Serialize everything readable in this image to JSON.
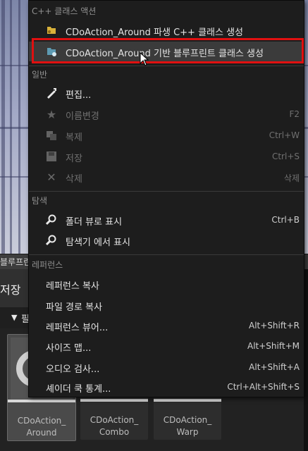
{
  "background": {
    "blueprint_tab": "블루프린",
    "save_label": "저장",
    "filter_label": "필"
  },
  "assets": [
    {
      "line1": "",
      "line2": "",
      "name_line1": "CDoAction_",
      "name_line2": "Around"
    },
    {
      "name_line1": "CDoAction_",
      "name_line2": "Combo"
    },
    {
      "name_line1": "CDoAction_",
      "name_line2": "Warp"
    }
  ],
  "menu": {
    "sections": {
      "cpp_actions": "C++ 클래스 액션",
      "general": "일반",
      "explore": "탐색",
      "references": "레퍼런스"
    },
    "cpp_items": [
      {
        "label": "CDoAction_Around 파생 C++ 클래스 생성",
        "icon": "cpp-class-icon"
      },
      {
        "label": "CDoAction_Around 기반 블루프린트 클래스 생성",
        "icon": "blueprint-class-icon"
      }
    ],
    "general_items": [
      {
        "label": "편집...",
        "shortcut": "",
        "icon": "edit-icon"
      },
      {
        "label": "이름변경",
        "shortcut": "F2",
        "icon": "rename-star-icon"
      },
      {
        "label": "복제",
        "shortcut": "Ctrl+W",
        "icon": "duplicate-icon"
      },
      {
        "label": "저장",
        "shortcut": "Ctrl+S",
        "icon": "save-icon"
      },
      {
        "label": "삭제",
        "shortcut": "삭제",
        "icon": "delete-x-icon"
      }
    ],
    "explore_items": [
      {
        "label": "폴더 뷰로 표시",
        "shortcut": "Ctrl+B",
        "icon": "magnifier-icon"
      },
      {
        "label": "탐색기 에서 표시",
        "shortcut": "",
        "icon": "magnifier-icon"
      }
    ],
    "reference_items": [
      {
        "label": "레퍼런스 복사",
        "shortcut": ""
      },
      {
        "label": "파일 경로 복사",
        "shortcut": ""
      },
      {
        "label": "레퍼런스 뷰어...",
        "shortcut": "Alt+Shift+R"
      },
      {
        "label": "사이즈 맵...",
        "shortcut": "Alt+Shift+M"
      },
      {
        "label": "오디오 검사...",
        "shortcut": "Alt+Shift+A"
      },
      {
        "label": "셰이더 쿡 통계...",
        "shortcut": "Ctrl+Alt+Shift+S"
      }
    ]
  },
  "colors": {
    "highlight_box": "#e01010",
    "menu_bg": "#1d1d1d"
  }
}
